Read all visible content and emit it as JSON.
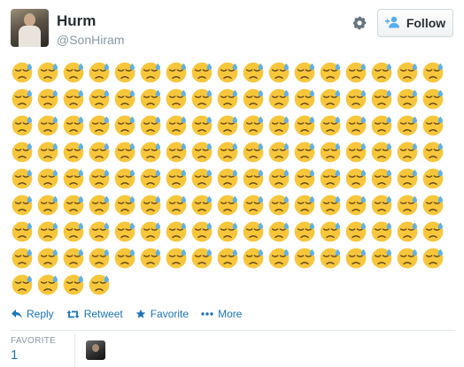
{
  "tweet": {
    "author_name": "Hurm",
    "author_handle": "@SonHiram",
    "emoji_count": 140
  },
  "header": {
    "follow_label": "Follow"
  },
  "actions": {
    "reply_label": "Reply",
    "retweet_label": "Retweet",
    "favorite_label": "Favorite",
    "more_label": "More"
  },
  "stats": {
    "favorites_label": "FAVORITE",
    "favorites_count": "1"
  },
  "icons": {
    "settings": "gear-icon",
    "follow": "add-user-icon",
    "reply": "reply-icon",
    "retweet": "retweet-icon",
    "favorite": "star-icon",
    "more": "more-dots-icon",
    "emoji": "disappointed-sweat-face-emoji"
  },
  "colors": {
    "link_blue": "#1b75bb",
    "muted_gray": "#8899a6",
    "emoji_yellow": "#f7c63b",
    "sweat_blue": "#5fb0e6"
  }
}
